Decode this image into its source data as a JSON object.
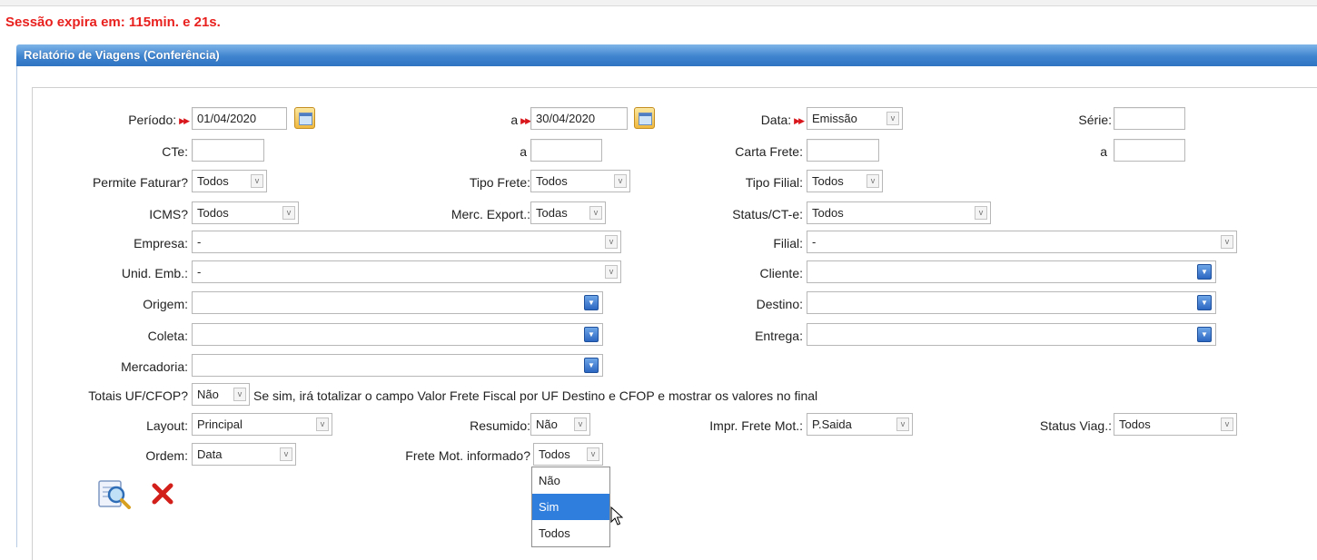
{
  "session": "Sessão expira em: 115min. e 21s.",
  "panel_title": "Relatório de Viagens (Conferência)",
  "labels": {
    "periodo": "Período:",
    "a1": "a",
    "data": "Data:",
    "serie": "Série:",
    "cte": "CTe:",
    "a2": "a",
    "carta_frete": "Carta Frete:",
    "a3": "a",
    "permite_faturar": "Permite Faturar?",
    "tipo_frete": "Tipo Frete:",
    "tipo_filial": "Tipo Filial:",
    "icms": "ICMS?",
    "merc_export": "Merc. Export.:",
    "status_cte": "Status/CT-e:",
    "empresa": "Empresa:",
    "filial": "Filial:",
    "unid_emb": "Unid. Emb.:",
    "cliente": "Cliente:",
    "origem": "Origem:",
    "destino": "Destino:",
    "coleta": "Coleta:",
    "entrega": "Entrega:",
    "mercadoria": "Mercadoria:",
    "totais": "Totais UF/CFOP?",
    "totais_hint": "Se sim, irá totalizar o campo Valor Frete Fiscal por UF Destino e CFOP e mostrar os valores no final",
    "layout": "Layout:",
    "resumido": "Resumido:",
    "impr_frete_mot": "Impr. Frete Mot.:",
    "status_viag": "Status Viag.:",
    "ordem": "Ordem:",
    "frete_mot_informado": "Frete Mot. informado?"
  },
  "values": {
    "periodo_inicio": "01/04/2020",
    "periodo_fim": "30/04/2020",
    "data": "Emissão",
    "serie_inicio": "",
    "serie_fim": "",
    "cte_inicio": "",
    "cte_fim": "",
    "carta_frete_inicio": "",
    "permite_faturar": "Todos",
    "tipo_frete": "Todos",
    "tipo_filial": "Todos",
    "icms": "Todos",
    "merc_export": "Todas",
    "status_cte": "Todos",
    "empresa": "-",
    "filial": "-",
    "unid_emb": "-",
    "cliente": "",
    "origem": "",
    "destino": "",
    "coleta": "",
    "entrega": "",
    "mercadoria": "",
    "totais": "Não",
    "layout": "Principal",
    "resumido": "Não",
    "impr_frete_mot": "P.Saida",
    "status_viag": "Todos",
    "ordem": "Data",
    "frete_mot_informado": "Todos"
  },
  "dropdown_options": [
    "Não",
    "Sim",
    "Todos"
  ],
  "dropdown_highlighted": "Sim",
  "icons": {
    "required": "double-red-arrow",
    "calendar": "calendar-icon",
    "search": "search-report-icon",
    "clear": "red-x-icon"
  },
  "colors": {
    "session_text": "#e8201e",
    "header_blue": "#3f84cf",
    "highlight": "#2f7ddc",
    "required_arrow": "#d8161b"
  }
}
